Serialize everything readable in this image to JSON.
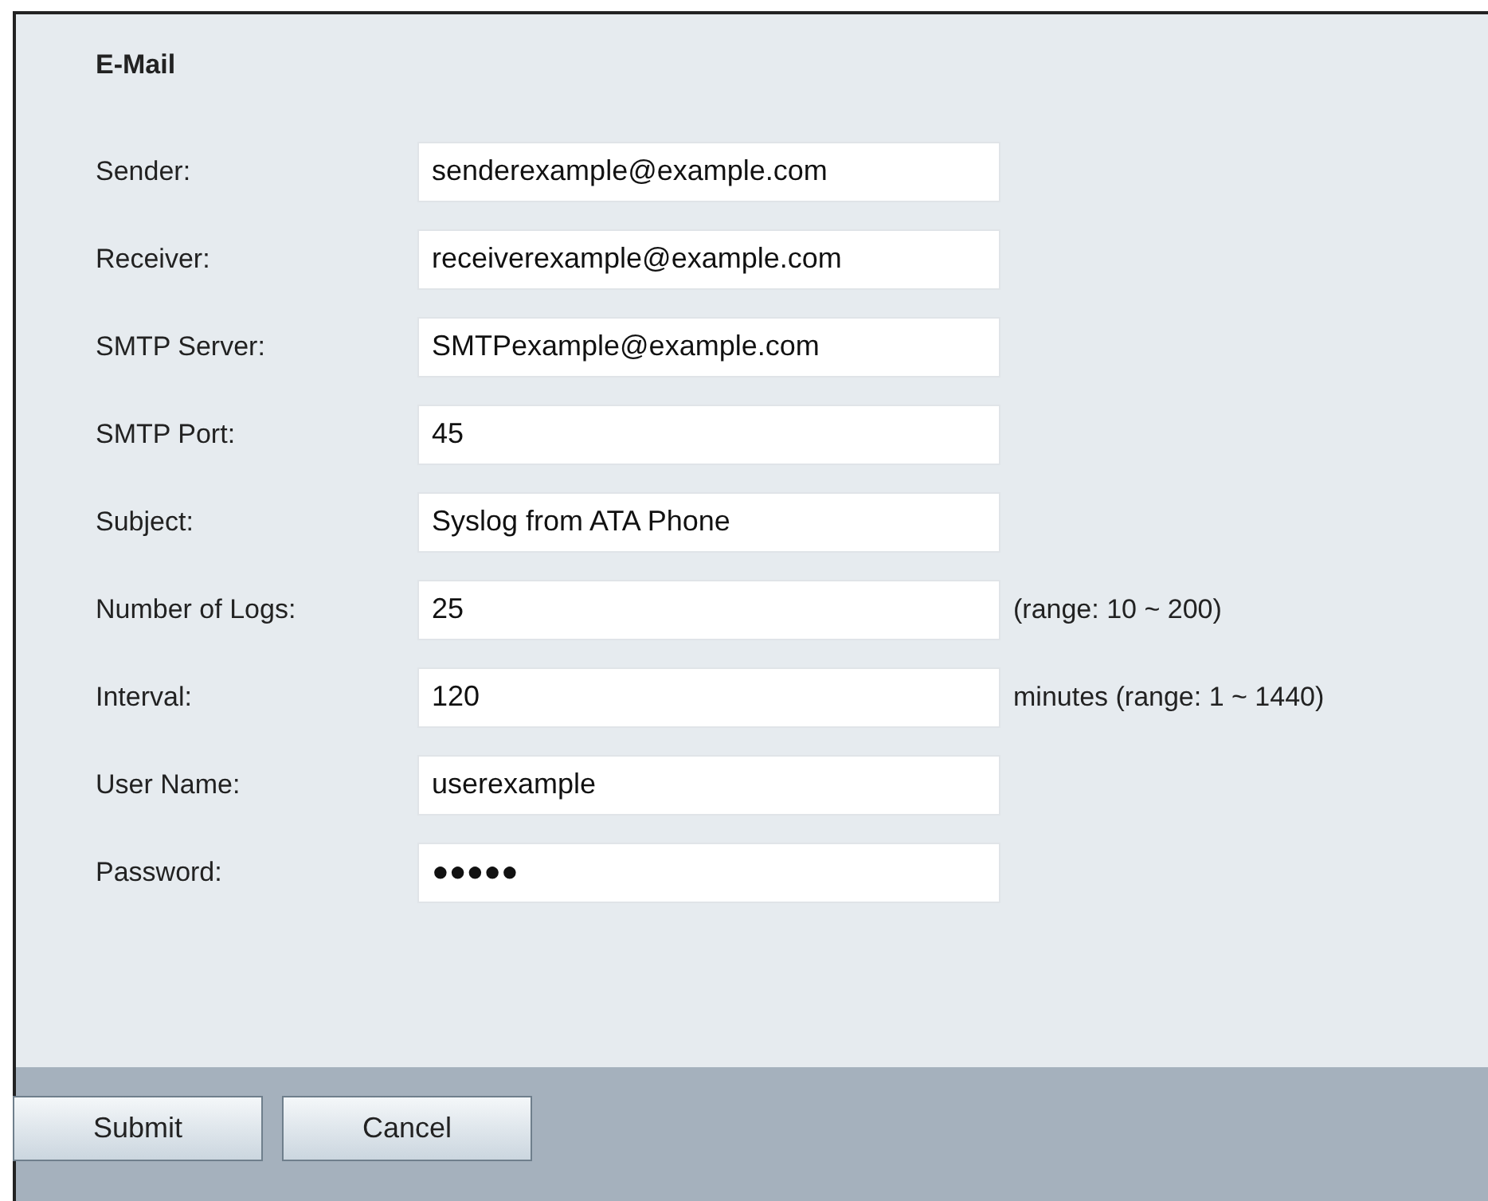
{
  "section_title": "E-Mail",
  "fields": [
    {
      "label": "Sender:",
      "value": "senderexample@example.com"
    },
    {
      "label": "Receiver:",
      "value": "receiverexample@example.com"
    },
    {
      "label": "SMTP Server:",
      "value": "SMTPexample@example.com"
    },
    {
      "label": "SMTP Port:",
      "value": "45"
    },
    {
      "label": "Subject:",
      "value": "Syslog from ATA Phone"
    },
    {
      "label": "Number of Logs:",
      "value": "25",
      "hint": "(range: 10 ~ 200)"
    },
    {
      "label": "Interval:",
      "value": "120",
      "hint": "minutes (range: 1 ~ 1440)"
    },
    {
      "label": "User Name:",
      "value": "userexample"
    },
    {
      "label": "Password:",
      "value": "●●●●●"
    }
  ],
  "buttons": [
    "Submit",
    "Cancel"
  ]
}
